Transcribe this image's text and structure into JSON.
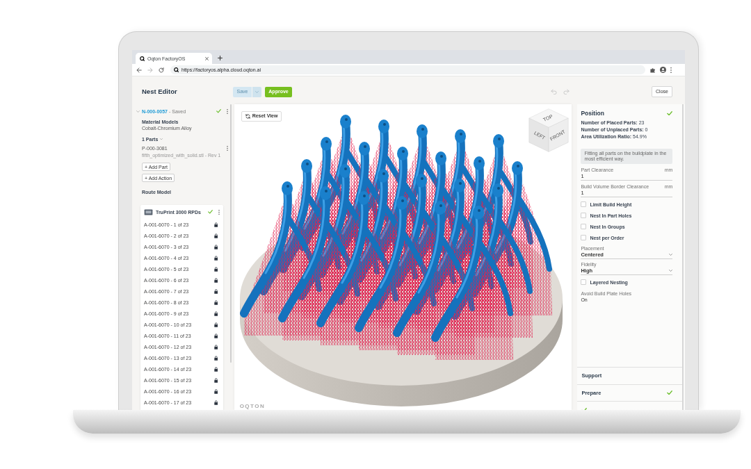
{
  "browser": {
    "tab_title": "Oqton FactoryOS",
    "url": "https://factoryos.alpha.cloud.oqton.ai"
  },
  "header": {
    "title": "Nest Editor",
    "actions": [
      {
        "kind": "split",
        "label": "Save",
        "disabled": true
      },
      {
        "kind": "primary",
        "label": "Approve",
        "disabled": false
      }
    ],
    "history": [
      {
        "kind": "undo",
        "disabled": true
      },
      {
        "kind": "redo",
        "disabled": true
      }
    ],
    "close": "Close"
  },
  "nest": {
    "expanded": true,
    "id": "N-000-0057",
    "status": "- Saved",
    "valid": true,
    "material": {
      "heading": "Material Models",
      "value": "Cobalt-Chromium Alloy"
    },
    "parts": {
      "heading": "1 Parts",
      "expanded": true,
      "items": [
        {
          "id": "P-000-3081",
          "file": "fifth_optimized_with_solid.stl - Rev 1"
        }
      ]
    },
    "buttons": [
      "+ Add Part",
      "+ Add Action"
    ]
  },
  "route": {
    "heading": "Route Model",
    "machine": {
      "name": "TruPrint 3000 RPDs",
      "valid": true
    },
    "builds": [
      {
        "label": "A-001-6070 - 1 of 23",
        "locked": true
      },
      {
        "label": "A-001-6070 - 2 of 23",
        "locked": true
      },
      {
        "label": "A-001-6070 - 3 of 23",
        "locked": true
      },
      {
        "label": "A-001-6070 - 4 of 23",
        "locked": true
      },
      {
        "label": "A-001-6070 - 5 of 23",
        "locked": true
      },
      {
        "label": "A-001-6070 - 6 of 23",
        "locked": true
      },
      {
        "label": "A-001-6070 - 7 of 23",
        "locked": true
      },
      {
        "label": "A-001-6070 - 8 of 23",
        "locked": true
      },
      {
        "label": "A-001-6070 - 9 of 23",
        "locked": true
      },
      {
        "label": "A-001-6070 - 10 of 23",
        "locked": true
      },
      {
        "label": "A-001-6070 - 11 of 23",
        "locked": true
      },
      {
        "label": "A-001-6070 - 12 of 23",
        "locked": true
      },
      {
        "label": "A-001-6070 - 13 of 23",
        "locked": true
      },
      {
        "label": "A-001-6070 - 14 of 23",
        "locked": true
      },
      {
        "label": "A-001-6070 - 15 of 23",
        "locked": true
      },
      {
        "label": "A-001-6070 - 16 of 23",
        "locked": true
      },
      {
        "label": "A-001-6070 - 17 of 23",
        "locked": true
      }
    ]
  },
  "viewport": {
    "reset": "Reset View",
    "cube": [
      "TOP",
      "LEFT",
      "FRONT"
    ],
    "brand": "OQTON"
  },
  "panel": {
    "title": "Position",
    "done": true,
    "stats": [
      "**Number of Placed Parts:** 23",
      "**Number of Unplaced Parts:** 0",
      "**Area Utilization Ratio:** 54.9%"
    ],
    "info": "Fitting all parts on the buildplate in the most efficient way.",
    "fields": [
      {
        "kind": "number",
        "label": "Part Clearance",
        "value": "1",
        "unit": "mm"
      },
      {
        "kind": "number",
        "label": "Build Volume Border Clearance",
        "value": "1",
        "unit": "mm"
      },
      {
        "kind": "checkbox",
        "label": "Limit Build Height",
        "checked": false
      },
      {
        "kind": "checkbox",
        "label": "Nest In Part Holes",
        "checked": false
      },
      {
        "kind": "checkbox",
        "label": "Nest In Groups",
        "checked": false
      },
      {
        "kind": "checkbox",
        "label": "Nest per Order",
        "checked": false
      },
      {
        "kind": "select",
        "label": "Placement",
        "value": "Centered"
      },
      {
        "kind": "select",
        "label": "Fidelity",
        "value": "High"
      },
      {
        "kind": "checkbox",
        "label": "Layered Nesting",
        "checked": false
      },
      {
        "kind": "readonly",
        "label": "Avoid Build Plate Holes",
        "value": "On"
      }
    ]
  },
  "steps": [
    {
      "title": "Support",
      "done": false
    },
    {
      "title": "Prepare",
      "done": true
    },
    {
      "done": true
    }
  ]
}
